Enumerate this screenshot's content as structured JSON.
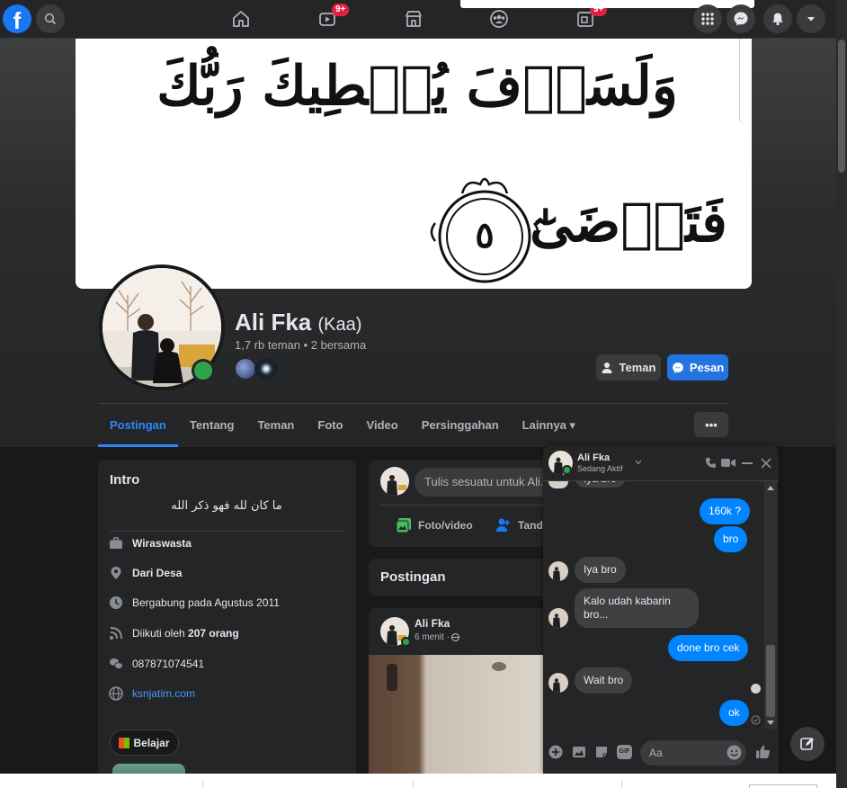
{
  "topbar": {
    "logo": "f",
    "watch_badge": "9+",
    "gaming_badge": "9+",
    "icons": [
      "search-icon",
      "home-icon",
      "watch-icon",
      "marketplace-icon",
      "groups-icon",
      "gaming-icon",
      "menu-grid-icon",
      "messenger-icon",
      "notifications-icon",
      "account-dropdown-icon"
    ]
  },
  "cover": {
    "line1": "وَلَسَوۡفَ يُعۡطِيكَ رَبُّكَ",
    "line2": "فَتَرۡضَىٰٓ",
    "verse_number": "٥"
  },
  "profile": {
    "name": "Ali Fka",
    "nickname": "(Kaa)",
    "friends": "1,7 rb teman • 2 bersama"
  },
  "actions": {
    "friends_label": "Teman",
    "message_label": "Pesan",
    "more_label": "•••"
  },
  "tabs": [
    {
      "label": "Postingan"
    },
    {
      "label": "Tentang"
    },
    {
      "label": "Teman"
    },
    {
      "label": "Foto"
    },
    {
      "label": "Video"
    },
    {
      "label": "Persinggahan"
    },
    {
      "label": "Lainnya ▾"
    }
  ],
  "intro": {
    "title": "Intro",
    "bio": "ما كان لله فهو ذكر الله",
    "items": [
      {
        "icon": "briefcase-icon",
        "text": "Wiraswasta"
      },
      {
        "icon": "location-icon",
        "text": "Dari Desa"
      },
      {
        "icon": "clock-icon",
        "text": "Bergabung pada Agustus 2011"
      },
      {
        "icon": "rss-icon",
        "text_prefix": "Diikuti oleh ",
        "text_bold": "207 orang"
      },
      {
        "icon": "chat-icon",
        "text": "087871074541"
      },
      {
        "icon": "globe-icon",
        "text": "ksnjatim.com"
      }
    ],
    "learn_label": "Belajar"
  },
  "composer": {
    "placeholder": "Tulis sesuatu untuk Ali...",
    "photo_label": "Foto/video",
    "tag_label": "Tandai"
  },
  "posts_section": {
    "title": "Postingan"
  },
  "post": {
    "author": "Ali Fka",
    "time": "6 menit · "
  },
  "chat": {
    "name": "Ali Fka",
    "status": "Sedang Aktif",
    "partial_top": "Iya bro",
    "messages": [
      {
        "from": "me",
        "text": "160k ?"
      },
      {
        "from": "me",
        "text": "bro"
      },
      {
        "from": "them",
        "text": "Iya bro"
      },
      {
        "from": "them",
        "text": "Kalo udah kabarin bro..."
      },
      {
        "from": "me",
        "text": "done bro cek"
      },
      {
        "from": "them",
        "text": "Wait bro"
      },
      {
        "from": "me",
        "text": "ok"
      }
    ],
    "input_placeholder": "Aa"
  },
  "colors": {
    "accent": "#2d88ff",
    "button_blue": "#2374e1",
    "bubble_blue": "#0084ff",
    "online": "#31a24c",
    "badge_red": "#e41e3f"
  }
}
